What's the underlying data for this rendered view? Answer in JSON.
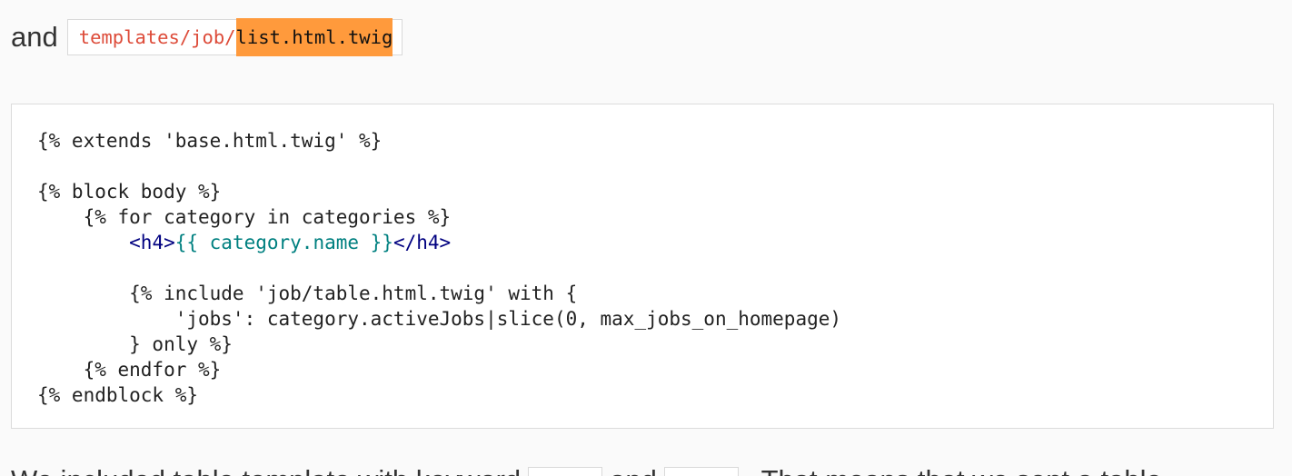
{
  "intro": {
    "text": "and",
    "path_prefix": "templates/job/",
    "path_highlight": "list.html.twig"
  },
  "code": {
    "line1": "{% extends 'base.html.twig' %}",
    "line2": "",
    "line3": "{% block body %}",
    "line4": "    {% for category in categories %}",
    "line5_indent": "        ",
    "line5_tag_open": "<h4>",
    "line5_expr": "{{ category.name }}",
    "line5_tag_close": "</h4>",
    "line6": "",
    "line7": "        {% include 'job/table.html.twig' with {",
    "line8": "            'jobs': category.activeJobs|slice(0, max_jobs_on_homepage)",
    "line9": "        } only %}",
    "line10": "    {% endfor %}",
    "line11": "{% endblock %}"
  },
  "bottom": {
    "part1": "We included table template with keyword",
    "part2": "and",
    "part3": ". That means that we sent a table"
  }
}
